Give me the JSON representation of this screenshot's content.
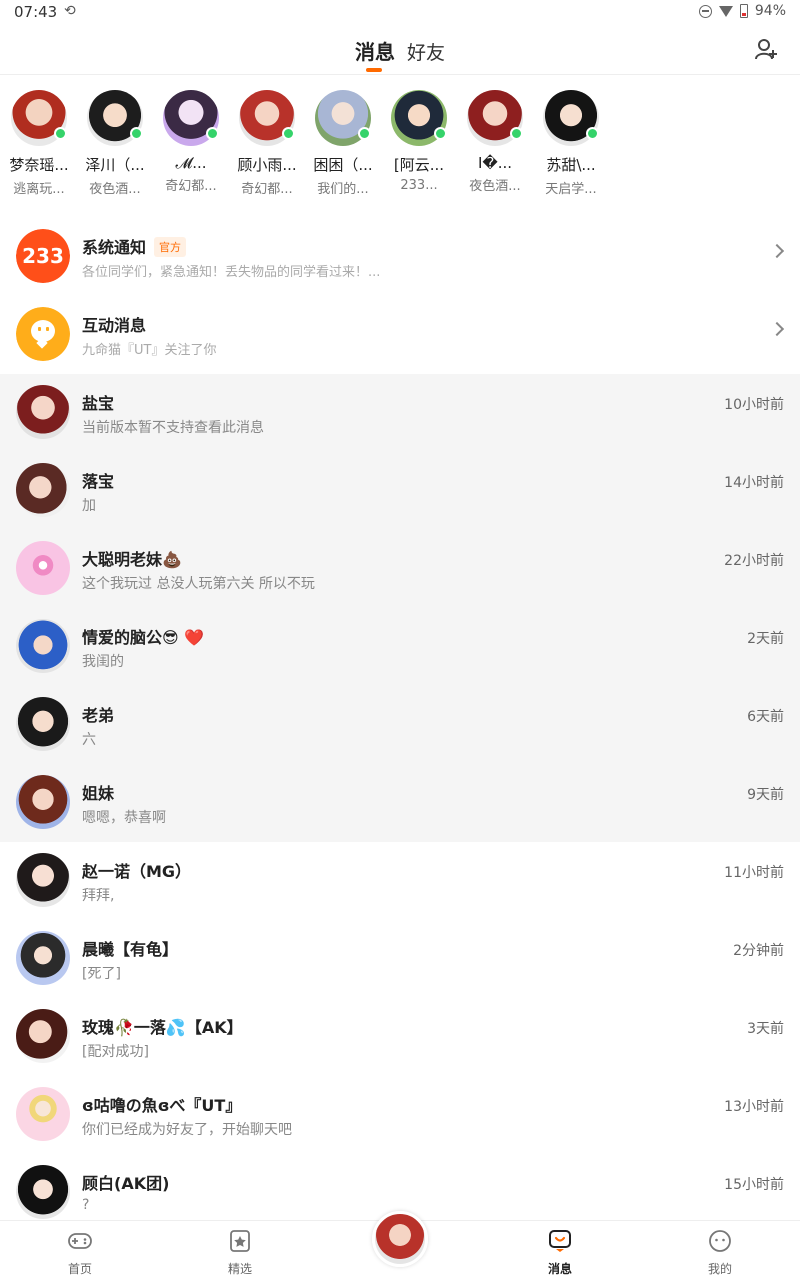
{
  "status_bar": {
    "time": "07:43",
    "battery": "94%"
  },
  "header": {
    "tab_messages": "消息",
    "tab_friends": "好友"
  },
  "online_friends": [
    {
      "name": "梦奈瑶...",
      "game": "逃离玩..."
    },
    {
      "name": "泽川（...",
      "game": "夜色酒..."
    },
    {
      "name": "𝓜...",
      "game": "奇幻都..."
    },
    {
      "name": "顾小雨...",
      "game": "奇幻都..."
    },
    {
      "name": "困困（...",
      "game": "我们的..."
    },
    {
      "name": "[阿云...",
      "game": "233..."
    },
    {
      "name": "I�...",
      "game": "夜色酒..."
    },
    {
      "name": "苏甜\\...",
      "game": "天启学..."
    }
  ],
  "system_items": [
    {
      "title": "系统通知",
      "badge": "官方",
      "icon_text": "233",
      "preview": "各位同学们，紧急通知！丢失物品的同学看过来！..."
    },
    {
      "title": "互动消息",
      "preview": "九命猫『UT』关注了你"
    }
  ],
  "conversations": [
    {
      "title": "盐宝",
      "preview": "当前版本暂不支持查看此消息",
      "time": "10小时前",
      "pinned": true
    },
    {
      "title": "落宝",
      "preview": "加",
      "time": "14小时前",
      "pinned": true
    },
    {
      "title": "大聪明老妹💩",
      "preview": "这个我玩过 总没人玩第六关 所以不玩",
      "time": "22小时前",
      "pinned": true
    },
    {
      "title": "情爱的脑公😎 ❤️",
      "preview": "我闺的",
      "time": "2天前",
      "pinned": true
    },
    {
      "title": "老弟",
      "preview": "六",
      "time": "6天前",
      "pinned": true
    },
    {
      "title": "姐妹",
      "preview": "嗯嗯，恭喜啊",
      "time": "9天前",
      "pinned": true
    },
    {
      "title": "赵一诺（MG）",
      "preview": "拜拜,",
      "time": "11小时前",
      "pinned": false
    },
    {
      "title": "晨曦【有龟】",
      "preview": "[死了]",
      "time": "2分钟前",
      "pinned": false
    },
    {
      "title": "玫瑰🥀一落💦【AK】",
      "preview": "[配对成功]",
      "time": "3天前",
      "pinned": false
    },
    {
      "title": "ɞ咕噜の魚ɞべ『UT』",
      "preview": "你们已经成为好友了，开始聊天吧",
      "time": "13小时前",
      "pinned": false
    },
    {
      "title": "顾白(AK团)",
      "preview": "?",
      "time": "15小时前",
      "pinned": false
    }
  ],
  "bottom_nav": {
    "home": "首页",
    "featured": "精选",
    "messages": "消息",
    "mine": "我的"
  },
  "colors": {
    "accent": "#ff6a00",
    "online": "#35d36a"
  }
}
